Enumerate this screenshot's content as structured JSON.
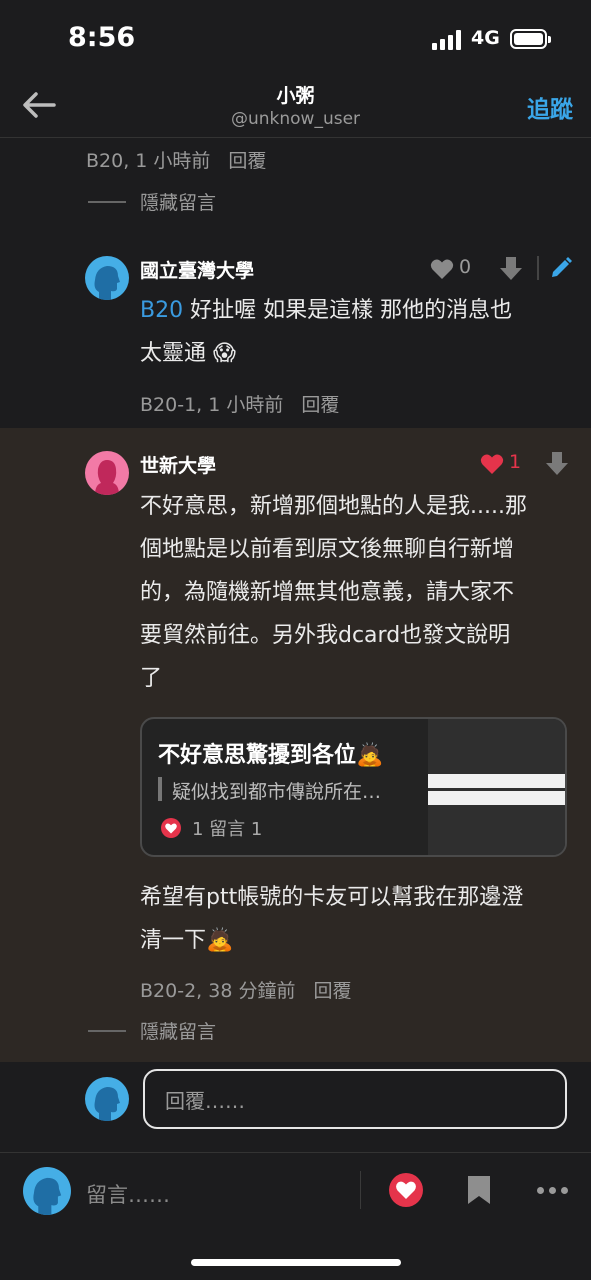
{
  "status_bar": {
    "time": "8:56",
    "network": "4G"
  },
  "header": {
    "title": "小粥",
    "subtitle": "@unknow_user",
    "follow_label": "追蹤"
  },
  "top": {
    "meta_floor": "B20, 1 小時前",
    "meta_reply": "回覆",
    "hide_label": "隱藏留言"
  },
  "comment1": {
    "user": "國立臺灣大學",
    "likes": "0",
    "mention": "B20",
    "text_line1": " 好扯喔 如果是這樣 那他的消息也",
    "text_line2": "太靈通 😱",
    "meta_floor": "B20-1, 1 小時前",
    "meta_reply": "回覆"
  },
  "comment2": {
    "user": "世新大學",
    "likes": "1",
    "text_lines": [
      "不好意思，新增那個地點的人是我.....那",
      "個地點是以前看到原文後無聊自行新增",
      "的，為隨機新增無其他意義，請大家不",
      "要貿然前往。另外我dcard也發文說明",
      "了"
    ],
    "link_card": {
      "title": "不好意思驚擾到各位🙇",
      "description": "疑似找到都市傳說所在…",
      "stats": "1 留言 1"
    },
    "text2_lines": [
      "希望有ptt帳號的卡友可以幫我在那邊澄",
      "清一下🙇"
    ],
    "meta_floor": "B20-2, 38 分鐘前",
    "meta_reply": "回覆",
    "hide_label": "隱藏留言"
  },
  "reply_input": {
    "placeholder": "回覆……"
  },
  "bottom_bar": {
    "comment_placeholder": "留言……"
  },
  "colors": {
    "accent": "#3aa6e8",
    "heart": "#e5344b",
    "highlight_bg": "#2d2824"
  }
}
